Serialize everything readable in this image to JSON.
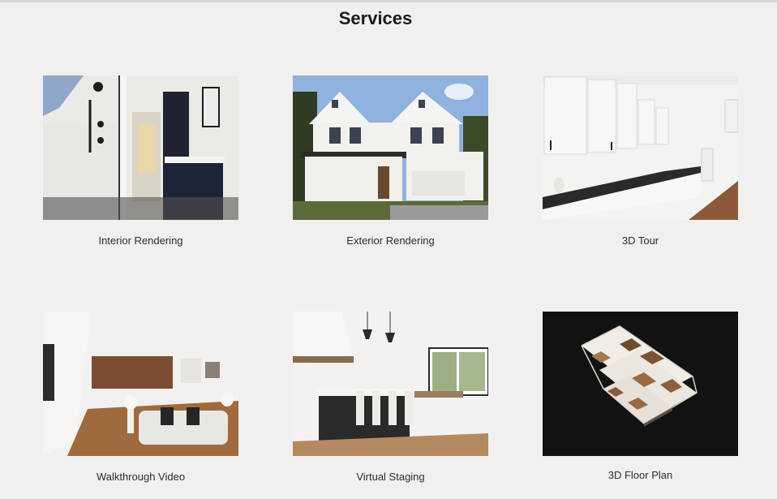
{
  "page": {
    "title": "Services"
  },
  "services": [
    {
      "label": "Interior Rendering",
      "image": "bathroom-interior-render"
    },
    {
      "label": "Exterior Rendering",
      "image": "house-exterior-render"
    },
    {
      "label": "3D Tour",
      "image": "kitchen-3d-tour"
    },
    {
      "label": "Walkthrough Video",
      "image": "living-room-walkthrough"
    },
    {
      "label": "Virtual Staging",
      "image": "staged-kitchen-island"
    },
    {
      "label": "3D Floor Plan",
      "image": "3d-floor-plan-model"
    }
  ]
}
